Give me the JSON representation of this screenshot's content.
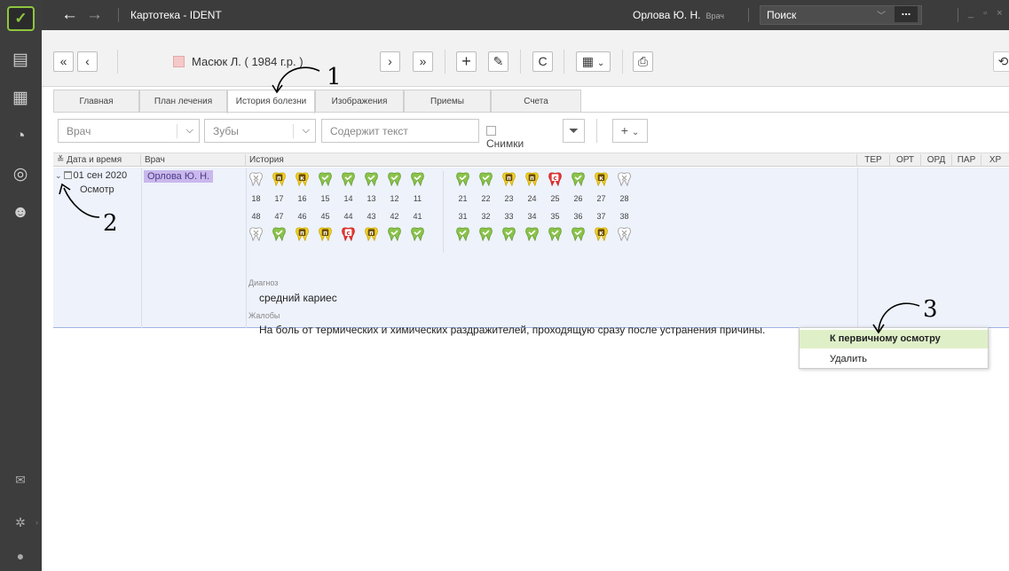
{
  "app": {
    "title": "Картотека - IDENT",
    "user": "Орлова Ю. Н.",
    "role": "Врач",
    "search": "Поиск",
    "search_btn": "..."
  },
  "patient": {
    "name": "Масюк Л. ( 1984 г.р. )"
  },
  "tabs": [
    {
      "label": "Главная"
    },
    {
      "label": "План лечения"
    },
    {
      "label": "История болезни"
    },
    {
      "label": "Изображения"
    },
    {
      "label": "Приемы"
    },
    {
      "label": "Счета"
    }
  ],
  "filters": {
    "doctor": "Врач",
    "teeth": "Зубы",
    "text": "Содержит текст",
    "images": "Снимки"
  },
  "columns": {
    "date": "Дата и время",
    "doctor": "Врач",
    "history": "История",
    "ter": "ТЕР",
    "ort": "ОРТ",
    "ord": "ОРД",
    "par": "ПАР",
    "hir": "ХР"
  },
  "record": {
    "date": "01 сен 2020",
    "type": "Осмотр",
    "doctor": "Орлова Ю. Н.",
    "diagnosis_label": "Диагноз",
    "diagnosis": "средний кариес",
    "complaints_label": "Жалобы",
    "complaints": "На боль от термических и химических раздражителей, проходящую сразу после устранения причины."
  },
  "teeth": {
    "upper": [
      {
        "n": "18",
        "s": "x"
      },
      {
        "n": "17",
        "s": "p"
      },
      {
        "n": "16",
        "s": "k"
      },
      {
        "n": "15",
        "s": "ok"
      },
      {
        "n": "14",
        "s": "ok"
      },
      {
        "n": "13",
        "s": "ok"
      },
      {
        "n": "12",
        "s": "ok"
      },
      {
        "n": "11",
        "s": "ok"
      },
      {
        "n": "21",
        "s": "ok"
      },
      {
        "n": "22",
        "s": "ok"
      },
      {
        "n": "23",
        "s": "p"
      },
      {
        "n": "24",
        "s": "p"
      },
      {
        "n": "25",
        "s": "c"
      },
      {
        "n": "26",
        "s": "ok"
      },
      {
        "n": "27",
        "s": "k"
      },
      {
        "n": "28",
        "s": "x"
      }
    ],
    "lower": [
      {
        "n": "48",
        "s": "x"
      },
      {
        "n": "47",
        "s": "ok"
      },
      {
        "n": "46",
        "s": "p"
      },
      {
        "n": "45",
        "s": "p"
      },
      {
        "n": "44",
        "s": "c"
      },
      {
        "n": "43",
        "s": "p"
      },
      {
        "n": "42",
        "s": "ok"
      },
      {
        "n": "41",
        "s": "ok"
      },
      {
        "n": "31",
        "s": "ok"
      },
      {
        "n": "32",
        "s": "ok"
      },
      {
        "n": "33",
        "s": "ok"
      },
      {
        "n": "34",
        "s": "ok"
      },
      {
        "n": "35",
        "s": "ok"
      },
      {
        "n": "36",
        "s": "ok"
      },
      {
        "n": "37",
        "s": "k"
      },
      {
        "n": "38",
        "s": "x"
      }
    ],
    "marks": {
      "p": "п",
      "k": "к",
      "c": "с"
    }
  },
  "context_menu": {
    "item1": "К первичному осмотру",
    "item2": "Удалить"
  },
  "annotations": {
    "a1": "1",
    "a2": "2",
    "a3": "3"
  },
  "colors": {
    "ok": "#8bc34a",
    "p": "#f2d22e",
    "k": "#f2d22e",
    "c": "#e53935",
    "x": "#ffffff",
    "accent": "#8ec63f"
  },
  "icons": {
    "back": "←",
    "fwd": "→",
    "first": "«",
    "prev": "‹",
    "next": "›",
    "last": "»",
    "add": "+",
    "edit": "✎",
    "refresh": "C",
    "cal": "▦",
    "print": "⎙",
    "chev": "⌄",
    "filter": "⏷",
    "history": "⟲"
  }
}
